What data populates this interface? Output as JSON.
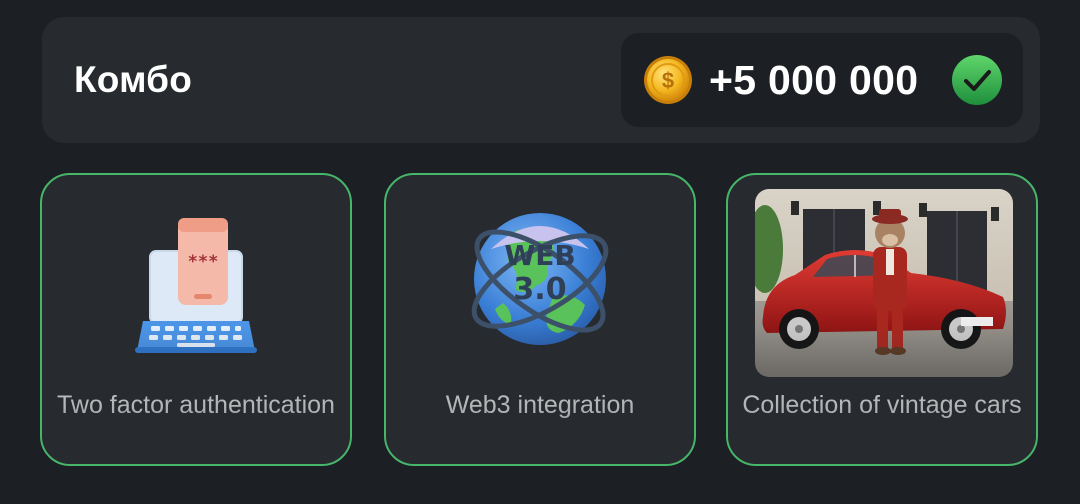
{
  "combo": {
    "title": "Комбо",
    "reward": "+5 000 000",
    "coin_icon": "coin-icon",
    "status_icon": "check-icon",
    "accent_color": "#47b56a"
  },
  "cards": [
    {
      "label": "Two factor authentication",
      "icon": "phone-laptop-2fa-icon"
    },
    {
      "label": "Web3 integration",
      "icon": "web3-globe-icon"
    },
    {
      "label": "Collection of vintage cars",
      "icon": "vintage-car-photo"
    }
  ]
}
